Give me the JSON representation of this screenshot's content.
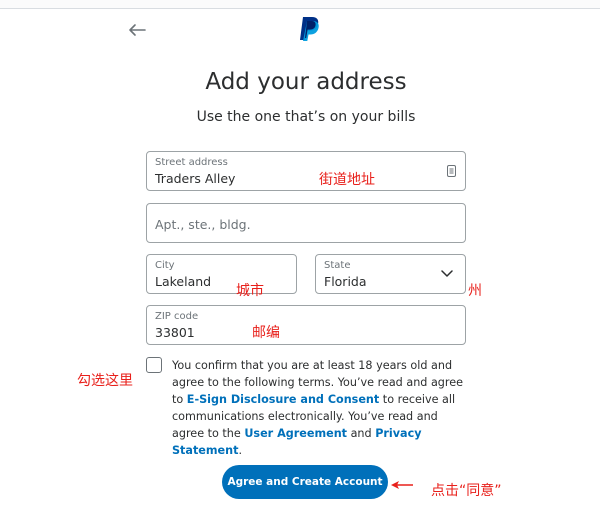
{
  "header": {
    "title": "Add your address",
    "subtitle": "Use the one that’s on your bills"
  },
  "street": {
    "label": "Street address",
    "value": "Traders Alley"
  },
  "apt": {
    "placeholder": "Apt., ste., bldg."
  },
  "city": {
    "label": "City",
    "value": "Lakeland"
  },
  "state": {
    "label": "State",
    "value": "Florida"
  },
  "zip": {
    "label": "ZIP code",
    "value": "33801"
  },
  "terms": {
    "part1": "You confirm that you are at least 18 years old and agree to the following terms. You’ve read and agree to ",
    "link1": "E-Sign Disclosure and Consent",
    "part2": " to receive all communications electronically. You’ve read and agree to the ",
    "link2": "User Agreement",
    "part3": " and ",
    "link3": "Privacy Statement",
    "part4": "."
  },
  "button": {
    "label": "Agree and Create Account"
  },
  "annotations": {
    "street": "街道地址",
    "city": "城市",
    "state": "州",
    "zip": "邮编",
    "checkbox": "勾选这里",
    "button": "点击“同意”"
  },
  "colors": {
    "accent": "#0070ba",
    "annotation": "#e8201b",
    "border": "#9da3a6"
  },
  "icons": [
    "back-arrow-icon",
    "paypal-logo",
    "address-book-icon",
    "chevron-down-icon",
    "red-arrow-icon"
  ]
}
